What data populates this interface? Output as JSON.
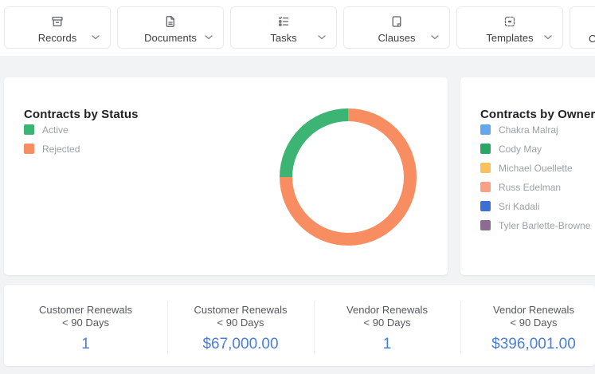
{
  "nav": {
    "items": [
      {
        "label": "Records",
        "icon": "archive-icon"
      },
      {
        "label": "Documents",
        "icon": "document-icon"
      },
      {
        "label": "Tasks",
        "icon": "checklist-icon"
      },
      {
        "label": "Clauses",
        "icon": "book-icon"
      },
      {
        "label": "Templates",
        "icon": "template-icon"
      },
      {
        "label": "C",
        "icon": "",
        "truncated_at_right_edge": true
      }
    ]
  },
  "status_chart": {
    "title": "Contracts by Status",
    "legend": [
      {
        "label": "Active",
        "color": "#3cb574"
      },
      {
        "label": "Rejected",
        "color": "#f98d62"
      }
    ],
    "segments_draw_order": [
      {
        "label": "Rejected",
        "pct": 75,
        "color": "#f98d62"
      },
      {
        "label": "Active",
        "pct": 25,
        "color": "#3cb574"
      }
    ]
  },
  "owner_chart": {
    "title": "Contracts by Owner",
    "legend": [
      {
        "label": "Chakra Malraj",
        "color": "#64a7ec"
      },
      {
        "label": "Cody May",
        "color": "#2ca666"
      },
      {
        "label": "Michael Ouellette",
        "color": "#f9c05e"
      },
      {
        "label": "Russ Edelman",
        "color": "#f7a086"
      },
      {
        "label": "Sri Kadali",
        "color": "#3e70d4"
      },
      {
        "label": "Tyler Barlette-Browne",
        "color": "#8d6b93"
      }
    ]
  },
  "stats": [
    {
      "title": "Customer Renewals",
      "sub": "< 90 Days",
      "value": "1"
    },
    {
      "title": "Customer Renewals",
      "sub": "< 90 Days",
      "value": "$67,000.00"
    },
    {
      "title": "Vendor Renewals",
      "sub": "< 90 Days",
      "value": "1"
    },
    {
      "title": "Vendor Renewals",
      "sub": "< 90 Days",
      "value": "$396,001.00"
    }
  ],
  "colors": {
    "accent_blue_value": "#4a7edb",
    "active_green": "#3cb574",
    "rejected_orange": "#f98d62",
    "page_gray": "#f2f3f5",
    "muted_text": "#9aa0a6"
  },
  "chart_data": [
    {
      "type": "pie",
      "subtype": "donut",
      "title": "Contracts by Status",
      "categories": [
        "Active",
        "Rejected"
      ],
      "values": [
        25,
        75
      ],
      "values_unit": "percent (estimated from arc angles; no numeric labels shown)",
      "colors": [
        "#3cb574",
        "#f98d62"
      ],
      "legend_position": "left"
    },
    {
      "type": "pie",
      "subtype": "donut",
      "title": "Contracts by Owner",
      "categories": [
        "Chakra Malraj",
        "Cody May",
        "Michael Ouellette",
        "Russ Edelman",
        "Sri Kadali",
        "Tyler Barlette-Browne"
      ],
      "colors": [
        "#64a7ec",
        "#2ca666",
        "#f9c05e",
        "#f7a086",
        "#3e70d4",
        "#8d6b93"
      ],
      "legend_position": "left",
      "note": "donut itself cut off at right edge of screenshot; only legend visible"
    }
  ]
}
